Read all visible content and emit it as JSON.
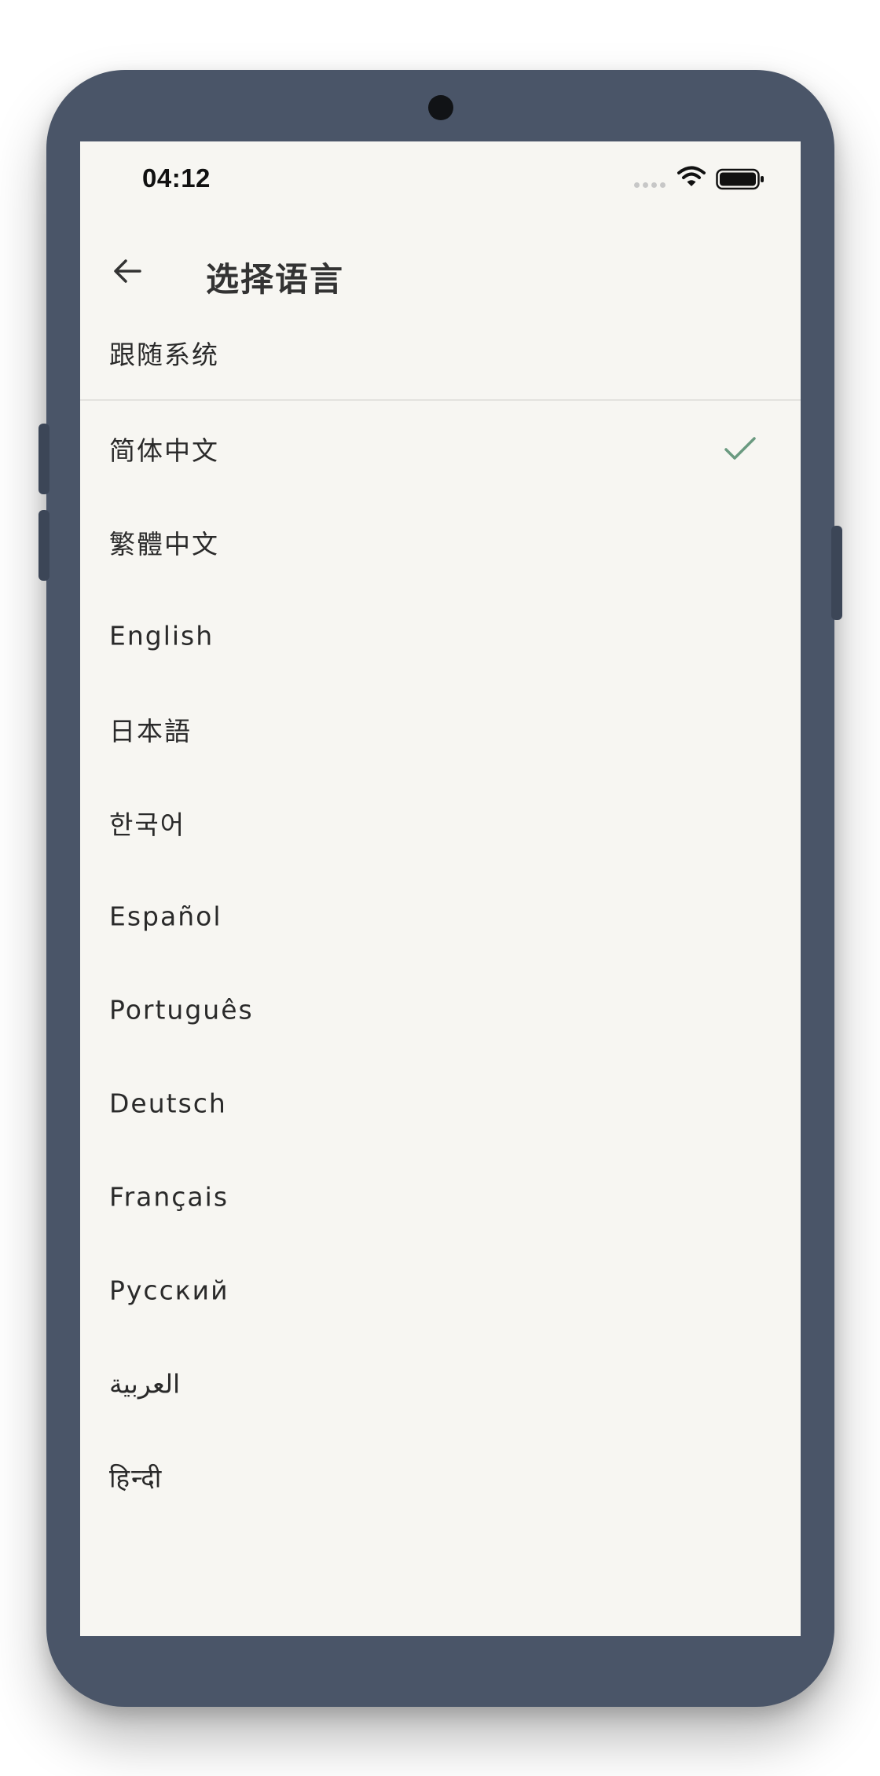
{
  "status_bar": {
    "time": "04:12"
  },
  "header": {
    "title": "选择语言"
  },
  "follow_system": {
    "label": "跟随系统"
  },
  "languages": [
    {
      "label": "简体中文",
      "selected": true
    },
    {
      "label": "繁體中文",
      "selected": false
    },
    {
      "label": "English",
      "selected": false
    },
    {
      "label": "日本語",
      "selected": false
    },
    {
      "label": "한국어",
      "selected": false
    },
    {
      "label": "Español",
      "selected": false
    },
    {
      "label": "Português",
      "selected": false
    },
    {
      "label": "Deutsch",
      "selected": false
    },
    {
      "label": "Français",
      "selected": false
    },
    {
      "label": "Русский",
      "selected": false
    },
    {
      "label": "العربية",
      "selected": false
    },
    {
      "label": "हिन्दी",
      "selected": false
    }
  ],
  "icons": {
    "back": "arrow-left-icon",
    "selected": "checkmark-icon",
    "wifi": "wifi-icon",
    "battery": "battery-icon",
    "signal": "signal-icon"
  },
  "colors": {
    "phone_frame": "#4a5568",
    "screen_bg": "#f7f6f2",
    "check": "#6a9a80",
    "title": "#333333",
    "text": "#2a2a2a",
    "divider": "#e3e2de"
  }
}
